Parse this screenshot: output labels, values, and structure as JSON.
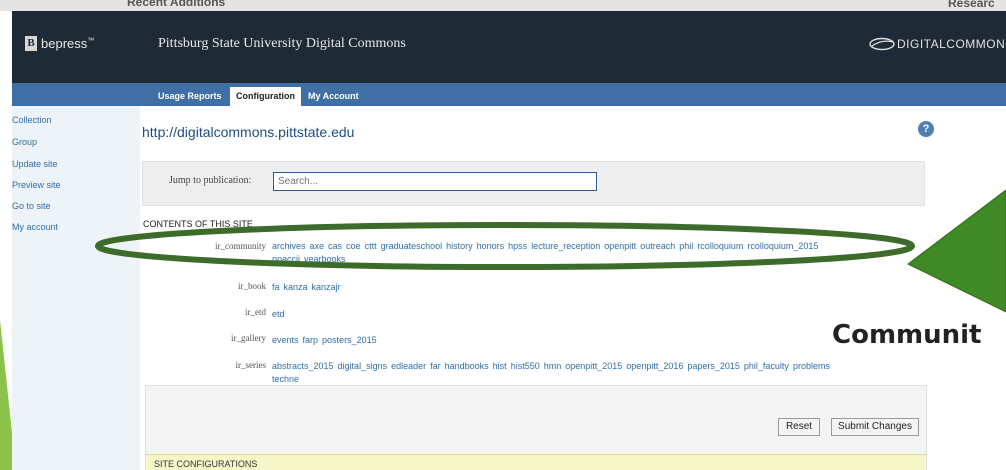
{
  "behind": {
    "left_text": "Recent Additions",
    "right_text": "Researc"
  },
  "header": {
    "brand_letter": "B",
    "brand_name": "bepress",
    "brand_tm": "™",
    "site_title": "Pittsburg State University Digital Commons",
    "logo_text": "DIGITALCOMMONS"
  },
  "nav": {
    "tabs": [
      {
        "label": "Usage Reports",
        "active": false
      },
      {
        "label": "Configuration",
        "active": true
      },
      {
        "label": "My Account",
        "active": false
      }
    ]
  },
  "sidebar": {
    "items": [
      {
        "label": "Collection"
      },
      {
        "label": "Group"
      },
      {
        "label": "Update site"
      },
      {
        "label": "Preview site"
      },
      {
        "label": "Go to site"
      },
      {
        "label": "My account"
      }
    ]
  },
  "main": {
    "url": "http://digitalcommons.pittstate.edu",
    "help_glyph": "?",
    "jump_label": "Jump to publication:",
    "search_placeholder": "Search...",
    "contents_heading": "CONTENTS OF THIS SITE",
    "rows": [
      {
        "label": "ir_community",
        "links_line1": [
          "archives",
          "axe",
          "cas",
          "coe",
          "cttt",
          "graduateschool",
          "history",
          "honors",
          "hpss",
          "lecture_reception",
          "openpitt",
          "outreach",
          "phil",
          "rcolloquium",
          "rcolloquium_2015"
        ],
        "links_line2": [
          "ppaccij",
          "yearbooks"
        ]
      },
      {
        "label": "ir_book",
        "links_line1": [
          "fa",
          "kanza",
          "kanzajr"
        ],
        "links_line2": []
      },
      {
        "label": "ir_etd",
        "links_line1": [
          "etd"
        ],
        "links_line2": []
      },
      {
        "label": "ir_gallery",
        "links_line1": [
          "events",
          "farp",
          "posters_2015"
        ],
        "links_line2": []
      },
      {
        "label": "ir_series",
        "links_line1": [
          "abstracts_2015",
          "digital_signs",
          "edleader",
          "far",
          "handbooks",
          "hist",
          "hist550",
          "hmn",
          "openpitt_2015",
          "openpitt_2016",
          "papers_2015",
          "phil_faculty",
          "problems"
        ],
        "links_line2": [
          "techne"
        ]
      }
    ],
    "reset_label": "Reset",
    "submit_label": "Submit Changes",
    "site_config_label": "SITE CONFIGURATIONS"
  },
  "annotation": {
    "callout_text": "Communit",
    "ellipse_color": "#3d6b2a",
    "arrow_color": "#3f8a25"
  }
}
